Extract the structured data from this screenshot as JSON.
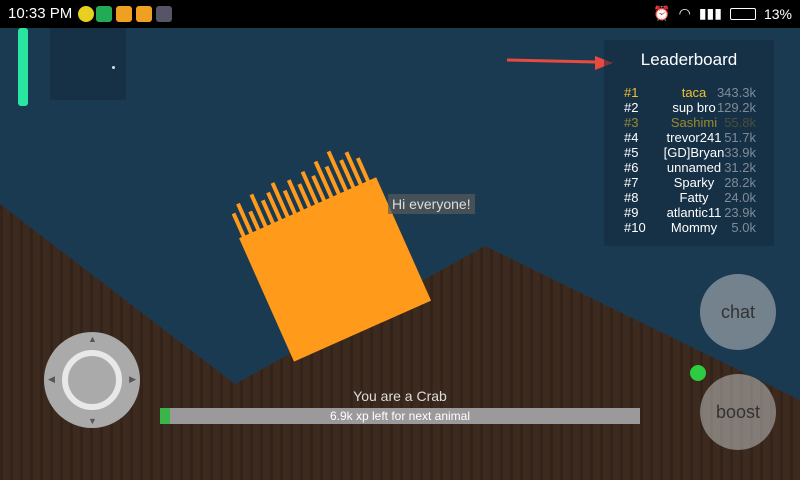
{
  "status_bar": {
    "time": "10:33 PM",
    "battery": "13%"
  },
  "leaderboard": {
    "title": "Leaderboard",
    "entries": [
      {
        "rank": "#1",
        "name": "taca",
        "score": "343.3k"
      },
      {
        "rank": "#2",
        "name": "sup bro",
        "score": "129.2k"
      },
      {
        "rank": "#3",
        "name": "Sashimi",
        "score": "55.8k"
      },
      {
        "rank": "#4",
        "name": "trevor241",
        "score": "51.7k"
      },
      {
        "rank": "#5",
        "name": "[GD]Bryan",
        "score": "33.9k"
      },
      {
        "rank": "#6",
        "name": "unnamed",
        "score": "31.2k"
      },
      {
        "rank": "#7",
        "name": "Sparky",
        "score": "28.2k"
      },
      {
        "rank": "#8",
        "name": "Fatty",
        "score": "24.0k"
      },
      {
        "rank": "#9",
        "name": "atlantic11",
        "score": "23.9k"
      },
      {
        "rank": "#10",
        "name": "Mommy",
        "score": "5.0k"
      }
    ]
  },
  "chat_message": "Hi everyone!",
  "buttons": {
    "chat": "chat",
    "boost": "boost"
  },
  "player": {
    "role_text": "You are a Crab",
    "xp_text": "6.9k xp left for next animal",
    "xp_progress": 0.02
  },
  "colors": {
    "sky": "#1a3a52",
    "ground": "#3d2a1f",
    "player": "#ff9a1a",
    "xp_fill": "#3ab54a",
    "accent_arrow": "#e84a3f"
  }
}
